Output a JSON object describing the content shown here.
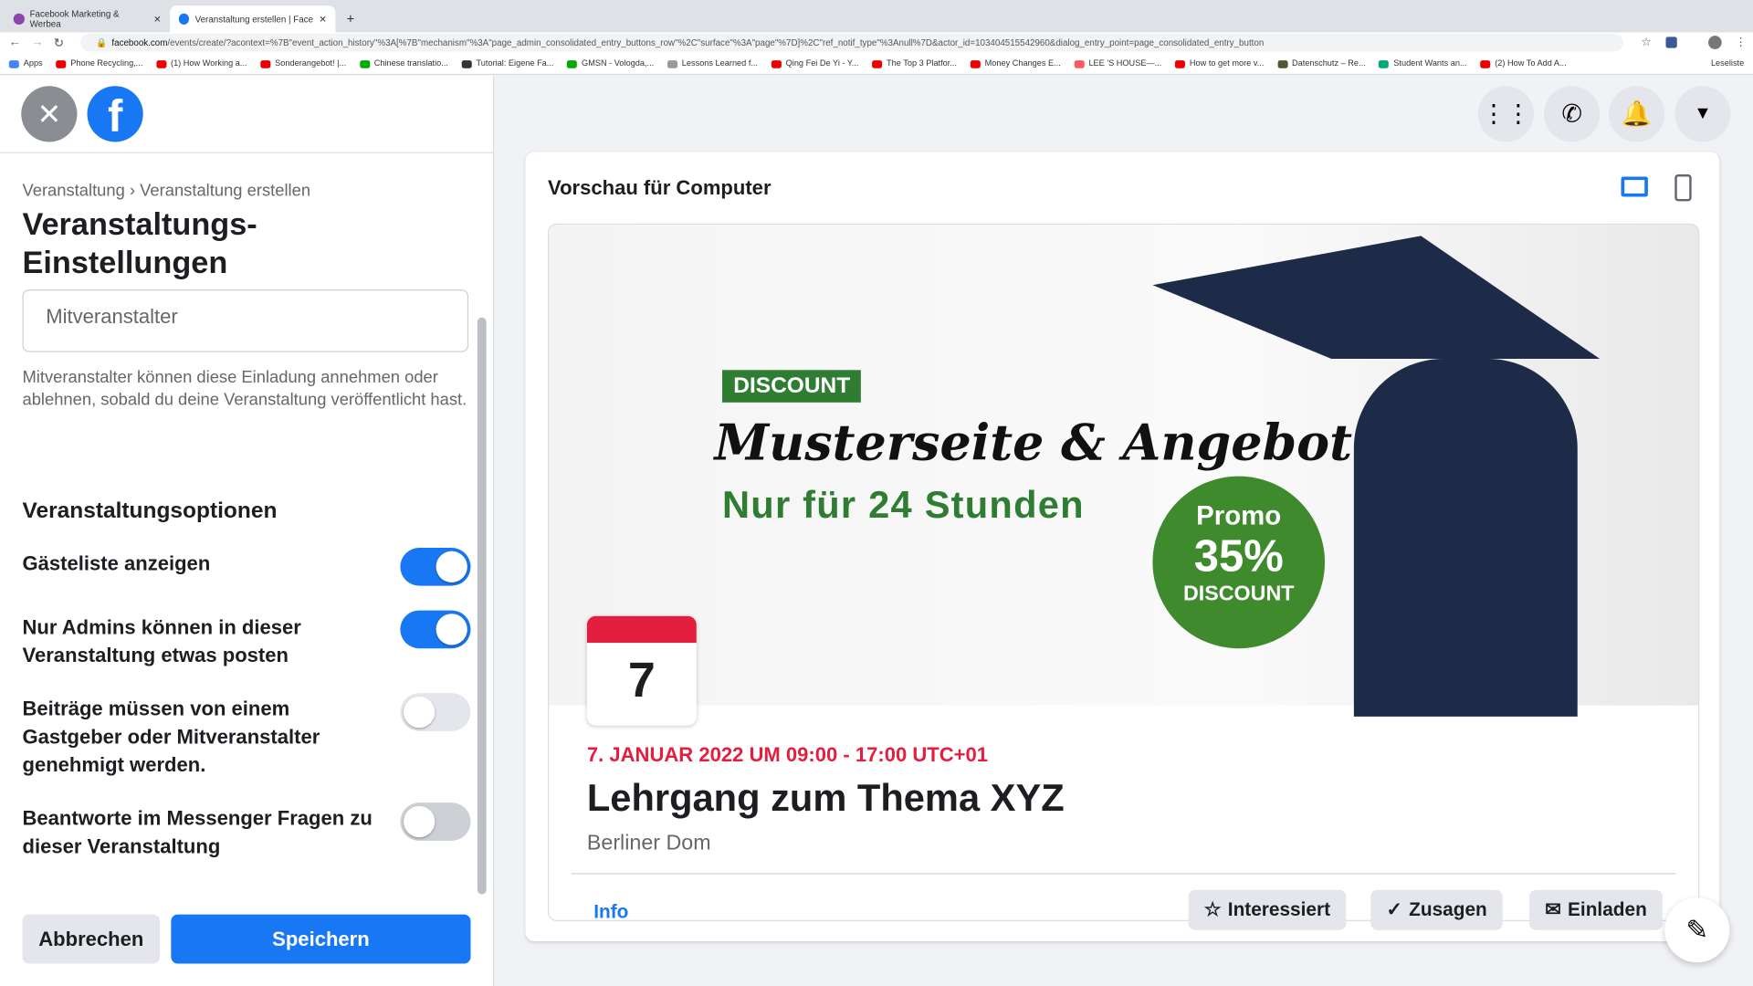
{
  "browser": {
    "tabs": [
      {
        "title": "Facebook Marketing & Werbea"
      },
      {
        "title": "Veranstaltung erstellen | Faceb"
      }
    ],
    "url_domain": "facebook.com",
    "url_path": "/events/create/?acontext=%7B\"event_action_history\"%3A[%7B\"mechanism\"%3A\"page_admin_consolidated_entry_buttons_row\"%2C\"surface\"%3A\"page\"%7D]%2C\"ref_notif_type\"%3Anull%7D&actor_id=103404515542960&dialog_entry_point=page_consolidated_entry_button",
    "bookmarks": [
      "Apps",
      "Phone Recycling,...",
      "(1) How Working a...",
      "Sonderangebot! |...",
      "Chinese translatio...",
      "Tutorial: Eigene Fa...",
      "GMSN - Vologda,...",
      "Lessons Learned f...",
      "Qing Fei De Yi - Y...",
      "The Top 3 Platfor...",
      "Money Changes E...",
      "LEE 'S HOUSE—...",
      "How to get more v...",
      "Datenschutz – Re...",
      "Student Wants an...",
      "(2) How To Add A..."
    ],
    "reading_list": "Leseliste"
  },
  "sidebar": {
    "breadcrumb_parent": "Veranstaltung",
    "breadcrumb_sep": "›",
    "breadcrumb_current": "Veranstaltung erstellen",
    "title_line1": "Veranstaltungs-",
    "title_line2": "Einstellungen",
    "cohost_value": "Mitveranstalter",
    "cohost_help": "Mitveranstalter können diese Einladung annehmen oder ablehnen, sobald du deine Veranstaltung veröffentlicht hast.",
    "options_heading": "Veranstaltungsoptionen",
    "options": [
      {
        "label": "Gästeliste anzeigen",
        "on": true
      },
      {
        "label": "Nur Admins können in dieser Veranstaltung etwas posten",
        "on": true
      },
      {
        "label": "Beiträge müssen von einem Gastgeber oder Mitveranstalter genehmigt werden.",
        "on": false
      },
      {
        "label": "Beantworte im Messenger Fragen zu dieser Veranstaltung",
        "on": false
      }
    ],
    "cancel": "Abbrechen",
    "save": "Speichern"
  },
  "preview": {
    "title": "Vorschau für Computer",
    "banner": {
      "tag": "DISCOUNT",
      "headline": "Musterseite & Angebot",
      "subline": "Nur für 24 Stunden",
      "promo": "Promo",
      "percent": "35%",
      "promo_sub": "DISCOUNT"
    },
    "calendar_day": "7",
    "date": "7. JANUAR 2022 UM 09:00 - 17:00 UTC+01",
    "event_name": "Lehrgang zum Thema XYZ",
    "location": "Berliner Dom",
    "tab_info": "Info",
    "interested": "Interessiert",
    "going": "Zusagen",
    "invite": "Einladen"
  },
  "colors": {
    "accent": "#1877f2",
    "date_red": "#e41e3f",
    "banner_green": "#2f7d32"
  }
}
